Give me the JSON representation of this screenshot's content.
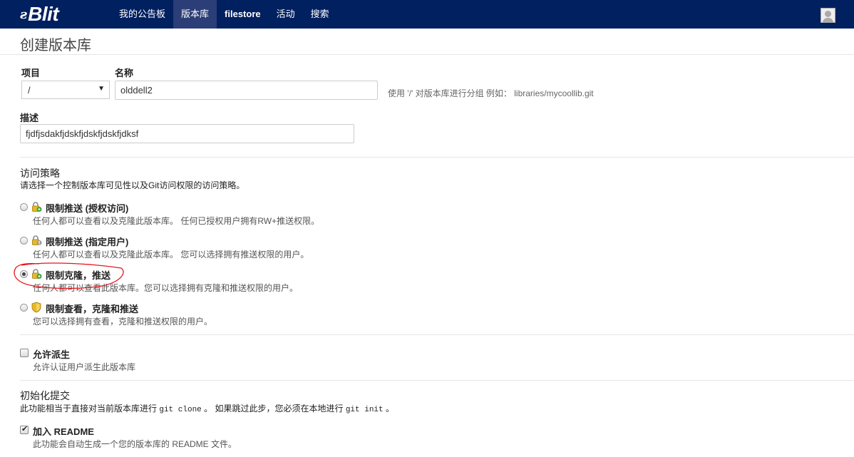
{
  "brand": {
    "mark": "ꙅ",
    "text": "Blit"
  },
  "nav": [
    {
      "label": "我的公告板"
    },
    {
      "label": "版本库"
    },
    {
      "label": "filestore"
    },
    {
      "label": "活动"
    },
    {
      "label": "搜索"
    }
  ],
  "page": {
    "title": "创建版本库"
  },
  "form": {
    "project_label": "项目",
    "project_value": "/",
    "name_label": "名称",
    "name_value": "olddell2",
    "name_hint": "使用 '/' 对版本库进行分组 例如： libraries/mycoollib.git",
    "desc_label": "描述",
    "desc_value": "fjdfjsdakfjdskfjdskfjdskfjdksf"
  },
  "access": {
    "title": "访问策略",
    "desc": "请选择一个控制版本库可见性以及Git访问权限的访问策略。",
    "options": [
      {
        "title": "限制推送 (授权访问)",
        "desc": "任何人都可以查看以及克隆此版本库。 任何已授权用户拥有RW+推送权限。",
        "checked": false,
        "icon": "green-lock-icon"
      },
      {
        "title": "限制推送 (指定用户)",
        "desc": "任何人都可以查看以及克隆此版本库。 您可以选择拥有推送权限的用户。",
        "checked": false,
        "icon": "gray-lock-icon"
      },
      {
        "title": "限制克隆，推送",
        "desc": "任何人都可以查看此版本库。您可以选择拥有克隆和推送权限的用户。",
        "checked": true,
        "icon": "green-lock-icon"
      },
      {
        "title": "限制查看，克隆和推送",
        "desc": "您可以选择拥有查看，克隆和推送权限的用户。",
        "checked": false,
        "icon": "shield-icon"
      }
    ]
  },
  "fork": {
    "title": "允许派生",
    "desc": "允许认证用户派生此版本库",
    "checked": false
  },
  "init": {
    "title": "初始化提交",
    "desc_a": "此功能相当于直接对当前版本库进行",
    "desc_code_a": "git clone",
    "desc_b": "。 如果跳过此步，您必须在本地进行",
    "desc_code_b": "git init",
    "desc_c": "。",
    "readme_title": "加入 README",
    "readme_desc": "此功能会自动生成一个您的版本库的 README 文件。",
    "readme_checked": true
  },
  "colors": {
    "navbar": "#002060",
    "nav_active": "#2c3e77",
    "annotation": "#e8141b"
  }
}
